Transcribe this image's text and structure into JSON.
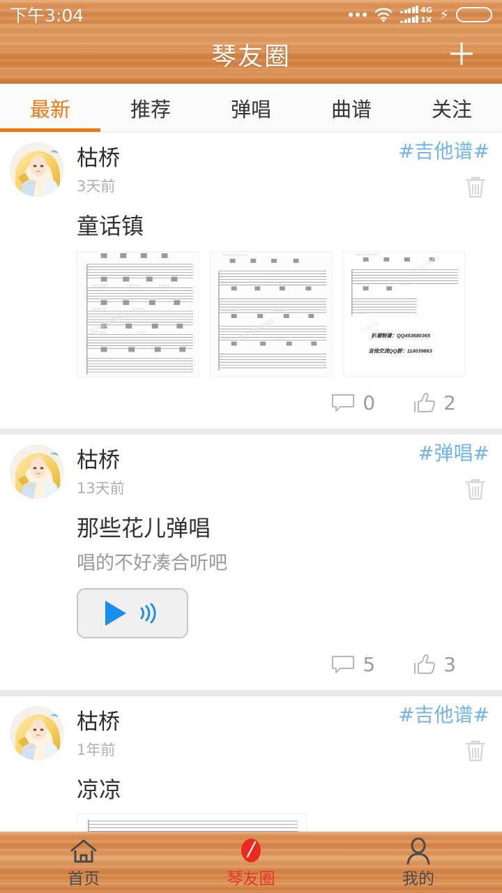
{
  "status_bar": {
    "time": "下午3:04",
    "icons": {
      "more": "more-dots-icon",
      "wifi": "wifi-icon",
      "signal_primary": "signal-bars-4g-icon",
      "signal_secondary": "signal-bars-1x-icon",
      "network_primary": "4G",
      "network_secondary": "1X",
      "charging": "charging-bolt-icon",
      "battery": "battery-icon"
    },
    "battery_color": "#2ec81e"
  },
  "header": {
    "title": "琴友圈",
    "add_label": "+",
    "add_icon": "plus-icon"
  },
  "tabs": {
    "active_index": 0,
    "accent": "#ee7710",
    "items": [
      {
        "label": "最新"
      },
      {
        "label": "推荐"
      },
      {
        "label": "弹唱"
      },
      {
        "label": "曲谱"
      },
      {
        "label": "关注"
      }
    ]
  },
  "posts": [
    {
      "author": "枯桥",
      "time": "3天前",
      "tag": "#吉他谱#",
      "title": "童话镇",
      "subtitle": "",
      "media_type": "sheet-thumbnails",
      "sheet_count": 3,
      "sheet_note_1": "扒谱制谱：QQ493680365",
      "sheet_note_2": "吉他交流QQ群：114039863",
      "comments": "0",
      "likes": "2",
      "delete_icon": "trash-icon",
      "comment_icon": "comment-icon",
      "like_icon": "thumbs-up-icon"
    },
    {
      "author": "枯桥",
      "time": "13天前",
      "tag": "#弹唱#",
      "title": "那些花儿弹唱",
      "subtitle": "唱的不好凑合听吧",
      "media_type": "audio-player",
      "play_icon": "play-icon",
      "sound_icon": "sound-wave-icon",
      "comments": "5",
      "likes": "3",
      "delete_icon": "trash-icon",
      "comment_icon": "comment-icon",
      "like_icon": "thumbs-up-icon"
    },
    {
      "author": "枯桥",
      "time": "1年前",
      "tag": "#吉他谱#",
      "title": "凉凉",
      "subtitle": "",
      "media_type": "sheet-wide",
      "delete_icon": "trash-icon"
    }
  ],
  "bottom_nav": {
    "active_index": 1,
    "active_color": "#e8342a",
    "items": [
      {
        "label": "首页",
        "icon": "home-icon"
      },
      {
        "label": "琴友圈",
        "icon": "guitar-pick-icon"
      },
      {
        "label": "我的",
        "icon": "person-icon"
      }
    ]
  },
  "colors": {
    "wood": "#d98b4e",
    "accent_orange": "#ee7710",
    "tag_blue": "#6fb3f0",
    "play_blue": "#1a8ef0",
    "nav_red": "#e8342a"
  }
}
